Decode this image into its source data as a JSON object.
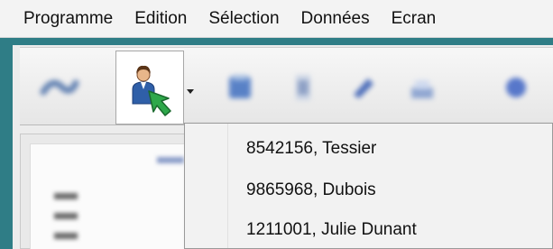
{
  "menubar": {
    "items": [
      "Programme",
      "Edition",
      "Sélection",
      "Données",
      "Ecran"
    ]
  },
  "toolbar": {
    "buttons": [
      {
        "icon": "blurred-arrow-icon"
      },
      {
        "icon": "user-arrow-icon",
        "pressed": true
      },
      {
        "icon": "blurred-book-icon"
      },
      {
        "icon": "blurred-doc-icon"
      },
      {
        "icon": "blurred-pen-icon"
      },
      {
        "icon": "blurred-tray-icon"
      },
      {
        "icon": "blurred-globe-icon"
      }
    ]
  },
  "dropdown": {
    "items": [
      {
        "label": "8542156, Tessier"
      },
      {
        "label": "9865968, Dubois"
      },
      {
        "label": "1211001, Julie Dunant"
      }
    ]
  },
  "colors": {
    "frame": "#2f7d86",
    "accent_green": "#2ea84a"
  }
}
